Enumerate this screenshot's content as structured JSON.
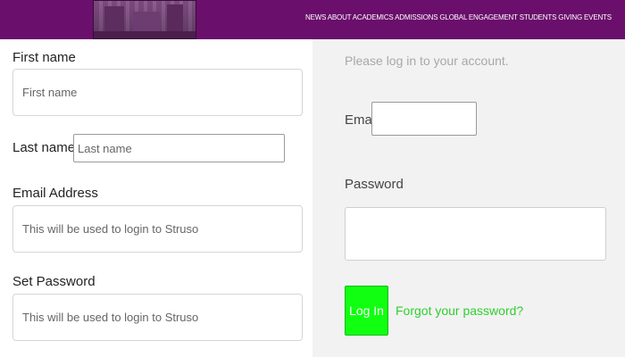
{
  "header": {
    "nav_text": "NEWS ABOUT ACADEMICS ADMISSIONS GLOBAL ENGAGEMENT STUDENTS GIVING EVENTS"
  },
  "registration": {
    "first_name_label": "First name",
    "first_name_placeholder": "First name",
    "last_name_label": "Last name",
    "last_name_placeholder": "Last name",
    "email_label": "Email Address",
    "email_placeholder": "This will be used to login to Struso",
    "password_label": "Set Password",
    "password_placeholder": "This will be used to login to Struso"
  },
  "login": {
    "intro": "Please log in to your account.",
    "email_label": "Email",
    "password_label": "Password",
    "login_button": "Log In",
    "forgot_link": "Forgot your password?"
  },
  "colors": {
    "topbar": "#6a0f6b",
    "login_button": "#11ff11",
    "forgot_link": "#2fcf2f"
  }
}
